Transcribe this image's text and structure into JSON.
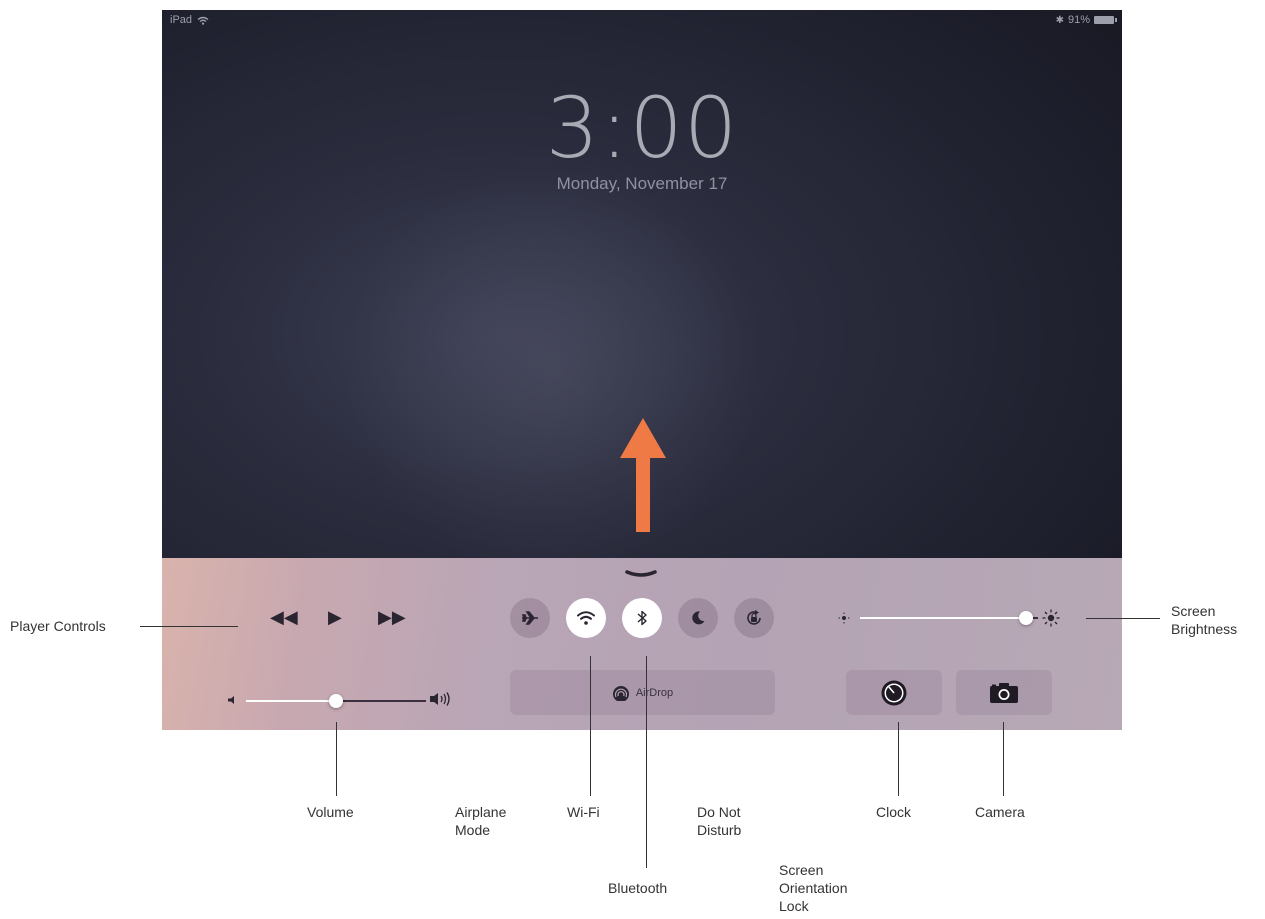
{
  "status_bar": {
    "device": "iPad",
    "battery": "91%"
  },
  "lock_screen": {
    "time": "3:00",
    "date": "Monday, November 17"
  },
  "control_center": {
    "player_controls": [
      "◀◀",
      "▶",
      "▶▶"
    ],
    "toggles": [
      "airplane-mode",
      "wi-fi",
      "bluetooth",
      "do-not-disturb",
      "orientation-lock"
    ],
    "toggles_on": [
      "wi-fi",
      "bluetooth"
    ],
    "volume_level": 0.5,
    "brightness_level": 0.93,
    "airdrop_label": "AirDrop",
    "apps": [
      "clock",
      "camera"
    ]
  },
  "callouts": {
    "player_controls": "Player Controls",
    "screen_brightness": "Screen Brightness",
    "volume": "Volume",
    "airplane_mode": "Airplane Mode",
    "wifi": "Wi-Fi",
    "do_not_disturb": "Do Not Disturb",
    "clock": "Clock",
    "camera": "Camera",
    "bluetooth": "Bluetooth",
    "orientation_lock": "Screen Orientation Lock"
  },
  "colors": {
    "arrow": "#ef7a45",
    "panel": "#b9a6b6",
    "toggle_on": "#ffffff"
  }
}
